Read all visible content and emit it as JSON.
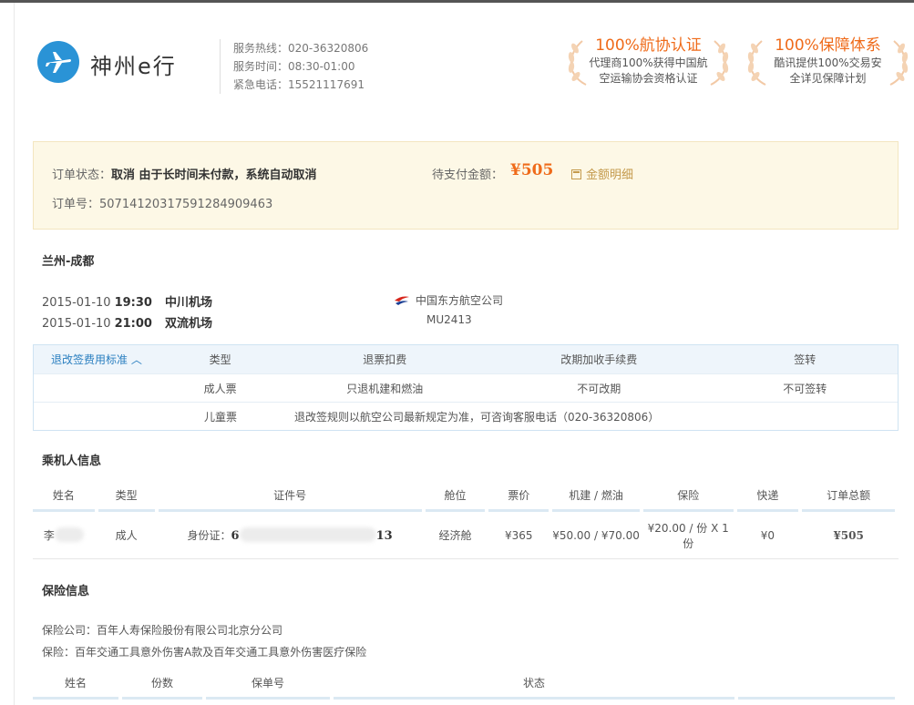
{
  "header": {
    "brand": "神州e行",
    "hotline": "服务热线：020-36320806",
    "service_time": "服务时间：08:30-01:00",
    "emergency": "紧急电话：15521117691",
    "badges": [
      {
        "title": "100%航协认证",
        "desc_line1": "代理商100%获得中国航",
        "desc_line2": "空运输协会资格认证"
      },
      {
        "title": "100%保障体系",
        "desc_line1": "酷讯提供100%交易安",
        "desc_line2": "全详见保障计划"
      }
    ]
  },
  "order": {
    "status_label": "订单状态：",
    "status_value": "取消 由于长时间未付款，系统自动取消",
    "pay_label": "待支付金额：",
    "pay_amount": "¥505",
    "detail_link": "金额明细",
    "order_no": "订单号：5071412031759128490946​3"
  },
  "route": {
    "title": "兰州-成都",
    "depart": {
      "date": "2015-01-10",
      "time": "19:30",
      "airport": "中川机场"
    },
    "arrive": {
      "date": "2015-01-10",
      "time": "21:00",
      "airport": "双流机场"
    },
    "airline": "中国东方航空公司",
    "flight_no": "MU2413"
  },
  "rules": {
    "toggle": "退改签费用标准 ︿",
    "headers": [
      "类型",
      "退票扣费",
      "改期加收手续费",
      "签转"
    ],
    "adult": [
      "成人票",
      "只退机建和燃油",
      "不可改期",
      "不可签转"
    ],
    "child_type": "儿童票",
    "child_note": "退改签规则以航空公司最新规定为准，可咨询客服电话（020-36320806）"
  },
  "passengers": {
    "title": "乘机人信息",
    "headers": [
      "姓名",
      "类型",
      "证件号",
      "舱位",
      "票价",
      "机建 / 燃油",
      "保险",
      "快递",
      "订单总额"
    ],
    "rows": [
      {
        "name": "李",
        "type": "成人",
        "id_label": "身份证：",
        "id_prefix": "6",
        "id_suffix": "13",
        "cabin": "经济舱",
        "price": "¥365",
        "tax": "¥50.00 / ¥70.00",
        "insurance": "¥20.00 / 份 X 1份",
        "express": "¥0",
        "total": "¥505"
      }
    ]
  },
  "insurance": {
    "title": "保险信息",
    "company": "保险公司：百年人寿保险股份有限公司北京分公司",
    "product": "保险：百年交通工具意外伤害A款及百年交通工具意外伤害医疗保险",
    "headers": [
      "姓名",
      "份数",
      "保单号",
      "状态"
    ]
  }
}
